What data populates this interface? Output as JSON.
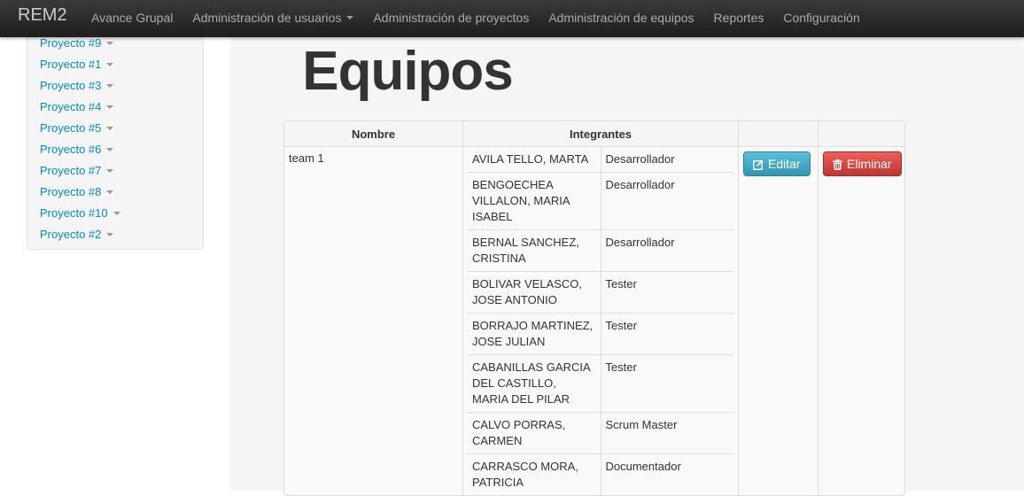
{
  "navbar": {
    "brand": "REM2",
    "items": [
      {
        "label": "Avance Grupal",
        "dropdown": false
      },
      {
        "label": "Administración de usuarios",
        "dropdown": true
      },
      {
        "label": "Administración de proyectos",
        "dropdown": false
      },
      {
        "label": "Administración de equipos",
        "dropdown": false
      },
      {
        "label": "Reportes",
        "dropdown": false
      },
      {
        "label": "Configuración",
        "dropdown": false
      }
    ]
  },
  "sidebar": {
    "items": [
      {
        "label": "Proyecto #9"
      },
      {
        "label": "Proyecto #1"
      },
      {
        "label": "Proyecto #3"
      },
      {
        "label": "Proyecto #4"
      },
      {
        "label": "Proyecto #5"
      },
      {
        "label": "Proyecto #6"
      },
      {
        "label": "Proyecto #7"
      },
      {
        "label": "Proyecto #8"
      },
      {
        "label": "Proyecto #10"
      },
      {
        "label": "Proyecto #2"
      }
    ]
  },
  "page": {
    "title": "Equipos"
  },
  "table": {
    "headers": {
      "name": "Nombre",
      "members": "Integrantes"
    },
    "rows": [
      {
        "name": "team 1",
        "edit_label": "Editar",
        "delete_label": "Eliminar",
        "members": [
          {
            "name": "AVILA TELLO, MARTA",
            "role": "Desarrollador"
          },
          {
            "name": "BENGOECHEA VILLALON, MARIA ISABEL",
            "role": "Desarrollador"
          },
          {
            "name": "BERNAL SANCHEZ, CRISTINA",
            "role": "Desarrollador"
          },
          {
            "name": "BOLIVAR VELASCO, JOSE ANTONIO",
            "role": "Tester"
          },
          {
            "name": "BORRAJO MARTINEZ, JOSE JULIAN",
            "role": "Tester"
          },
          {
            "name": "CABANILLAS GARCIA DEL CASTILLO, MARIA DEL PILAR",
            "role": "Tester"
          },
          {
            "name": "CALVO PORRAS, CARMEN",
            "role": "Scrum Master"
          },
          {
            "name": "CARRASCO MORA, PATRICIA",
            "role": "Documentador"
          }
        ]
      }
    ]
  },
  "colors": {
    "link": "#0088cc",
    "info_button": "#49afcd",
    "danger_button": "#da4f49",
    "navbar": "#222222"
  }
}
